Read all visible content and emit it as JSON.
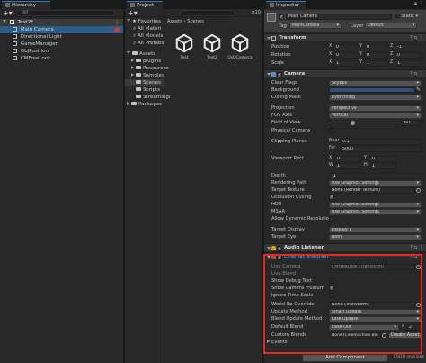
{
  "hierarchy": {
    "tab": "Hierarchy",
    "search_placeholder": "All",
    "scene_name": "Test2*",
    "items": [
      "Main Camera",
      "Directional Light",
      "GameManager",
      "ObjPosition",
      "CMFreeLook"
    ]
  },
  "project": {
    "tab": "Project",
    "favorites_label": "Favorites",
    "favorites": [
      "All Materi",
      "All Models",
      "All Prefabs"
    ],
    "assets_label": "Assets",
    "asset_folders": [
      "plugins",
      "Resources",
      "Samples",
      "Scenes",
      "Scripts",
      "Streamingi"
    ],
    "packages_label": "Packages",
    "breadcrumb": [
      "Assets",
      "Scenes"
    ],
    "count_badge": "10",
    "scene_assets": [
      "Test",
      "Test2",
      "UsDCamera"
    ]
  },
  "inspector": {
    "tab": "Inspector",
    "object_name": "Main Camera",
    "static_label": "Static",
    "tag_label": "Tag",
    "tag_value": "MainCamera",
    "layer_label": "Layer",
    "layer_value": "Default",
    "transform": {
      "title": "Transform",
      "rows": [
        {
          "label": "Position",
          "x": "0",
          "y": "0",
          "z": "-1"
        },
        {
          "label": "Rotation",
          "x": "0",
          "y": "0",
          "z": "0"
        },
        {
          "label": "Scale",
          "x": "1",
          "y": "1",
          "z": "1"
        }
      ]
    },
    "camera": {
      "title": "Camera",
      "clear_flags_label": "Clear Flags",
      "clear_flags": "Skybox",
      "background_label": "Background",
      "background_color": "#314d79",
      "culling_mask_label": "Culling Mask",
      "culling_mask": "Everything",
      "projection_label": "Projection",
      "projection": "Perspective",
      "fov_axis_label": "FOV Axis",
      "fov_axis": "Vertical",
      "fov_label": "Field of View",
      "fov_value": "60",
      "fov_fraction": 0.33,
      "physical_label": "Physical Camera",
      "clipping_label": "Clipping Planes",
      "near_label": "Near",
      "near_value": "0.1",
      "far_label": "Far",
      "far_value": "5000",
      "viewport_label": "Viewport Rect",
      "viewport": {
        "x": "0",
        "y": "0",
        "w": "1",
        "h": "1"
      },
      "depth_label": "Depth",
      "depth_value": "-1",
      "rendering_path_label": "Rendering Path",
      "rendering_path": "Use Graphics Settings",
      "target_texture_label": "Target Texture",
      "target_texture": "None (Render Texture)",
      "occlusion_label": "Occlusion Culling",
      "hdr_label": "HDR",
      "hdr_value": "Use Graphics Settings",
      "msaa_label": "MSAA",
      "msaa_value": "Use Graphics Settings",
      "dynres_label": "Allow Dynamic Resolution",
      "target_display_label": "Target Display",
      "target_display": "Display 1",
      "target_eye_label": "Target Eye",
      "target_eye": "Both"
    },
    "audio_listener": {
      "title": "Audio Listener"
    },
    "brain": {
      "title": "CinemachineBrain",
      "live_camera_label": "Live Camera",
      "live_camera": "CMFreeLook (Transform)",
      "live_blend_label": "Live Blend",
      "show_debug_label": "Show Debug Text",
      "show_frustum_label": "Show Camera Frustum",
      "ignore_timescale_label": "Ignore Time Scale",
      "world_up_label": "World Up Override",
      "world_up": "None (Transform)",
      "update_method_label": "Update Method",
      "update_method": "Smart Update",
      "blend_update_label": "Blend Update Method",
      "blend_update": "Late Update",
      "default_blend_label": "Default Blend",
      "default_blend": "Ease Out",
      "blend_s_label": "s",
      "blend_time": "2",
      "custom_blends_label": "Custom Blends",
      "custom_blends": "None (Cinemachine Ble",
      "create_asset_label": "Create Asset",
      "events_label": "Events"
    },
    "add_component_label": "Add Component"
  },
  "watermark": "CSDN @yuiabs"
}
